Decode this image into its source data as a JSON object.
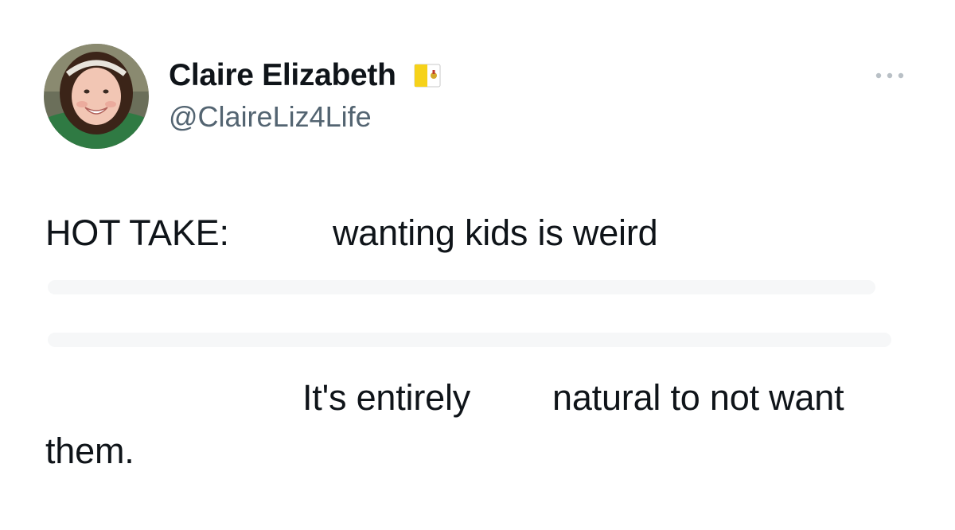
{
  "author": {
    "display_name": "Claire Elizabeth",
    "handle": "@ClaireLiz4Life",
    "flag_icon": "vatican-flag-icon"
  },
  "menu": {
    "icon": "more-options-icon"
  },
  "tweet": {
    "segments": [
      "HOT TAKE:",
      "wanting kids is weird",
      "It's entirely",
      "natural to not want",
      "them."
    ]
  },
  "colors": {
    "text": "#0f1419",
    "secondary_text": "#536471",
    "background": "#ffffff"
  }
}
